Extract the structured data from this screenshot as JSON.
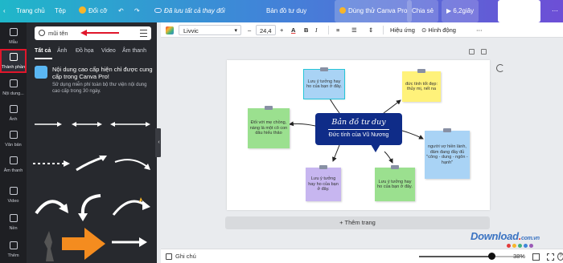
{
  "topbar": {
    "back_glyph": "‹",
    "home": "Trang chủ",
    "file": "Tệp",
    "resize": "Đổi cỡ",
    "undo_glyph": "↶",
    "redo_glyph": "↷",
    "saved_status": "Đã lưu tất cả thay đổi",
    "doc_title": "Bản đồ tư duy",
    "trial": "Dùng thử Canva Pro",
    "share": "Chia sẻ",
    "play": "▶ 6,2giây",
    "download": "⤓ Tải xuống",
    "more_glyph": "⋯"
  },
  "rail": [
    {
      "label": "Mẫu",
      "icon": "template-icon"
    },
    {
      "label": "Thành phần",
      "icon": "elements-icon",
      "active": true
    },
    {
      "label": "Nội dung...",
      "icon": "upload-icon"
    },
    {
      "label": "Ảnh",
      "icon": "photo-icon"
    },
    {
      "label": "Văn bản",
      "icon": "text-icon"
    },
    {
      "label": "Âm thanh",
      "icon": "audio-icon"
    },
    {
      "label": "Video",
      "icon": "video-icon"
    },
    {
      "label": "Nền",
      "icon": "background-icon"
    },
    {
      "label": "Thêm",
      "icon": "more-icon"
    }
  ],
  "panel": {
    "search_value": "mũi tên",
    "tabs": [
      "Tất cả",
      "Ảnh",
      "Đồ họa",
      "Video",
      "Âm thanh"
    ],
    "promo_title": "Nội dung cao cấp hiện chỉ được cung cấp trong Canva Pro!",
    "promo_sub": "Sử dụng miễn phí toàn bộ thư viện nội dung cao cấp trong 30 ngày."
  },
  "toolbar": {
    "font": "Livvic",
    "font_chevron": "▾",
    "minus": "–",
    "size": "24,4",
    "plus": "+",
    "color_glyph": "A",
    "bold": "B",
    "italic": "I",
    "align_glyph": "≡",
    "list_glyph": "☰",
    "spacing_glyph": "⇕",
    "effects": "Hiệu ứng",
    "animate": "⊙ Hình động",
    "more_glyph": "⋯"
  },
  "canvas": {
    "center_title": "Bản đồ tư duy",
    "center_sub": "Đức tính của Vũ Nương",
    "note_generic": "Lưu ý tưởng hay ho của bạn ở đây.",
    "note_top_right": "đức tính tốt đẹp: thủy mị, nết na",
    "note_left": "Đối với mẹ chồng, nàng là một cô con dâu hiếu thảo",
    "note_right": "người vợ hiền lành, đảm đang đầy đủ \"công - dung - ngôn - hạnh\"",
    "add_page": "+ Thêm trang"
  },
  "bottombar": {
    "notes": "Ghi chú",
    "zoom": "38%",
    "zoom_fraction": 0.38,
    "help_glyph": "?"
  },
  "watermark": {
    "name": "Download",
    "dot": ".",
    "tld": "com.vn"
  },
  "colors": {
    "note_blue": "#a9d3f5",
    "note_yellow": "#fff27a",
    "note_green": "#9be08f",
    "note_purple": "#c7b6f0",
    "center_box": "#0f2c88",
    "active_outline": "#e0162b"
  }
}
